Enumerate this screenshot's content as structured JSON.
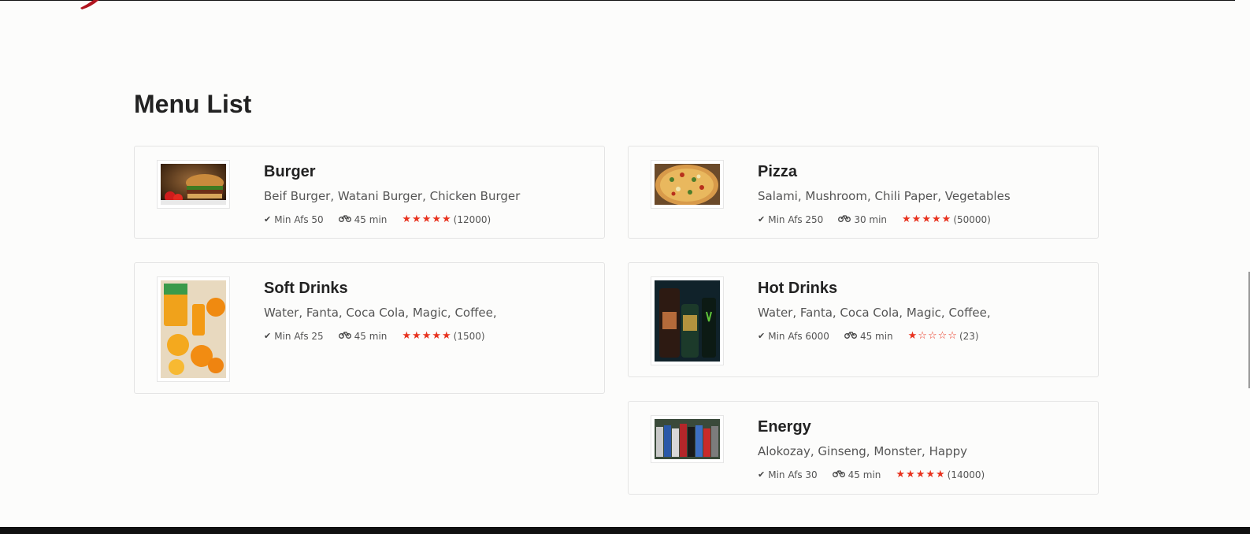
{
  "section": {
    "title": "Menu List"
  },
  "colors": {
    "star": "#e8321e",
    "accent_logo": "#b0141e"
  },
  "items": [
    {
      "name": "Burger",
      "description": "Beif Burger, Watani Burger, Chicken Burger",
      "min_order": "Min Afs 50",
      "delivery_time": "45 min",
      "rating": 5,
      "reviews": "(12000)",
      "image": "burger-photo"
    },
    {
      "name": "Pizza",
      "description": "Salami, Mushroom, Chili Paper, Vegetables",
      "min_order": "Min Afs 250",
      "delivery_time": "30 min",
      "rating": 5,
      "reviews": "(50000)",
      "image": "pizza-photo"
    },
    {
      "name": "Soft Drinks",
      "description": "Water, Fanta, Coca Cola, Magic, Coffee,",
      "min_order": "Min Afs 25",
      "delivery_time": "45 min",
      "rating": 5,
      "reviews": "(1500)",
      "image": "soft-drinks-photo"
    },
    {
      "name": "Hot Drinks",
      "description": "Water, Fanta, Coca Cola, Magic, Coffee,",
      "min_order": "Min Afs 6000",
      "delivery_time": "45 min",
      "rating": 1,
      "reviews": "(23)",
      "image": "hot-drinks-photo"
    },
    {
      "name": "Energy",
      "description": "Alokozay, Ginseng, Monster, Happy",
      "min_order": "Min Afs 30",
      "delivery_time": "45 min",
      "rating": 5,
      "reviews": "(14000)",
      "image": "energy-drinks-photo"
    }
  ]
}
